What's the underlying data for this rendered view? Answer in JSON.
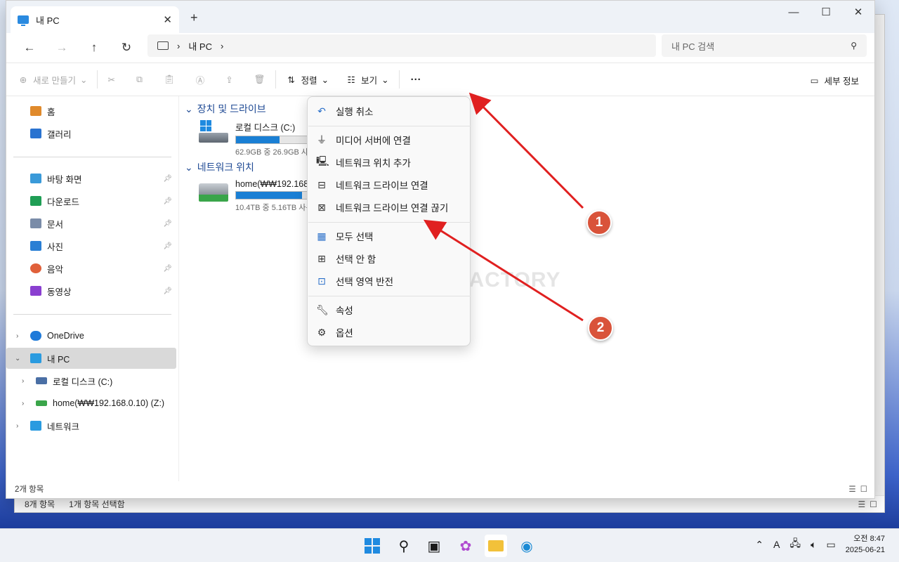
{
  "window": {
    "tab_title": "내 PC",
    "new_tab": "+",
    "minimize": "—",
    "maximize": "☐",
    "close": "✕"
  },
  "nav": {
    "address_segments": [
      "내 PC"
    ],
    "search_placeholder": "내 PC 검색"
  },
  "toolbar": {
    "new_label": "새로 만들기",
    "sort_label": "정렬",
    "view_label": "보기",
    "more_label": "···",
    "details_label": "세부 정보"
  },
  "sidebar": {
    "quick": [
      {
        "label": "홈",
        "icon": "home-icon",
        "color": "#e08a2c"
      },
      {
        "label": "갤러리",
        "icon": "gallery-icon",
        "color": "#2a73d0"
      }
    ],
    "pinned": [
      {
        "label": "바탕 화면",
        "icon": "desktop-icon",
        "color": "#3a9ad9"
      },
      {
        "label": "다운로드",
        "icon": "download-icon",
        "color": "#1f9e55"
      },
      {
        "label": "문서",
        "icon": "document-icon",
        "color": "#7a8ca8"
      },
      {
        "label": "사진",
        "icon": "pictures-icon",
        "color": "#2a7fd4"
      },
      {
        "label": "음악",
        "icon": "music-icon",
        "color": "#e0603a"
      },
      {
        "label": "동영상",
        "icon": "video-icon",
        "color": "#8a3fd0"
      }
    ],
    "tree": [
      {
        "label": "OneDrive",
        "icon": "onedrive-icon",
        "color": "#1f7ad9"
      },
      {
        "label": "내 PC",
        "icon": "pc-icon",
        "color": "#2a9be0"
      },
      {
        "label": "로컬 디스크 (C:)",
        "icon": "disk-icon",
        "color": "#4a6fa5"
      },
      {
        "label": "home(₩₩192.168.0.10) (Z:)",
        "icon": "network-drive-icon",
        "color": "#3aa54a"
      },
      {
        "label": "네트워크",
        "icon": "network-icon",
        "color": "#2a9be0"
      }
    ]
  },
  "content": {
    "group_devices": "장치 및 드라이브",
    "group_network": "네트워크 위치",
    "drives": [
      {
        "name": "로컬 디스크 (C:)",
        "size": "62.9GB 중 26.9GB 사용 가능",
        "used_fraction": 0.57
      },
      {
        "name": "home(₩₩192.168.0.10) (Z:)",
        "size": "10.4TB 중 5.16TB 사용 가능",
        "used_fraction": 0.87
      }
    ]
  },
  "status": {
    "items": "2개 항목",
    "bg_items": "8개 항목",
    "bg_selected": "1개 항목 선택함"
  },
  "menu": {
    "undo": "실행 취소",
    "media": "미디어 서버에 연결",
    "add_location": "네트워크 위치 추가",
    "map_drive": "네트워크 드라이브 연결",
    "disconnect_drive": "네트워크 드라이브 연결 끊기",
    "select_all": "모두 선택",
    "select_none": "선택 안 함",
    "invert": "선택 영역 반전",
    "properties": "속성",
    "options": "옵션"
  },
  "watermark": "MANUAL FACTORY",
  "annotations": {
    "badge1": "1",
    "badge2": "2",
    "arrow_color": "#e02020"
  },
  "taskbar": {
    "time": "오전 8:47",
    "date": "2025-06-21"
  }
}
